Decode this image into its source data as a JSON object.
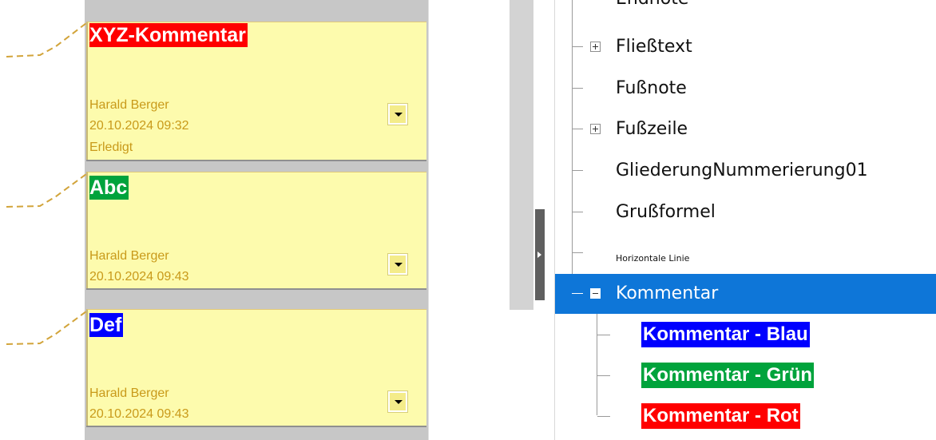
{
  "comments": [
    {
      "title": "XYZ-Kommentar",
      "title_bg": "#ff0000",
      "author": "Harald Berger",
      "date": "20.10.2024 09:32",
      "status": "Erledigt"
    },
    {
      "title": "Abc",
      "title_bg": "#00a33c",
      "author": "Harald Berger",
      "date": "20.10.2024 09:43"
    },
    {
      "title": "Def",
      "title_bg": "#0000ff",
      "author": "Harald Berger",
      "date": "20.10.2024 09:43"
    }
  ],
  "styles_tree": {
    "partial_top_item": "Endnote",
    "items": [
      {
        "label": "Fließtext",
        "expander": "plus"
      },
      {
        "label": "Fußnote"
      },
      {
        "label": "Fußzeile",
        "expander": "plus"
      },
      {
        "label": "GliederungNummerierung01"
      },
      {
        "label": "Grußformel"
      },
      {
        "label": "Horizontale Linie"
      },
      {
        "label": "Kommentar",
        "expander": "minus",
        "selected": true
      }
    ],
    "children": [
      {
        "label": "Kommentar - Blau",
        "bg": "#0000ff"
      },
      {
        "label": "Kommentar - Grün",
        "bg": "#00a33c"
      },
      {
        "label": "Kommentar - Rot",
        "bg": "#ff0000"
      }
    ]
  },
  "colors": {
    "selection": "#0e76d8",
    "comment_fill": "#fdfbad",
    "meta_text": "#c99a1a"
  }
}
